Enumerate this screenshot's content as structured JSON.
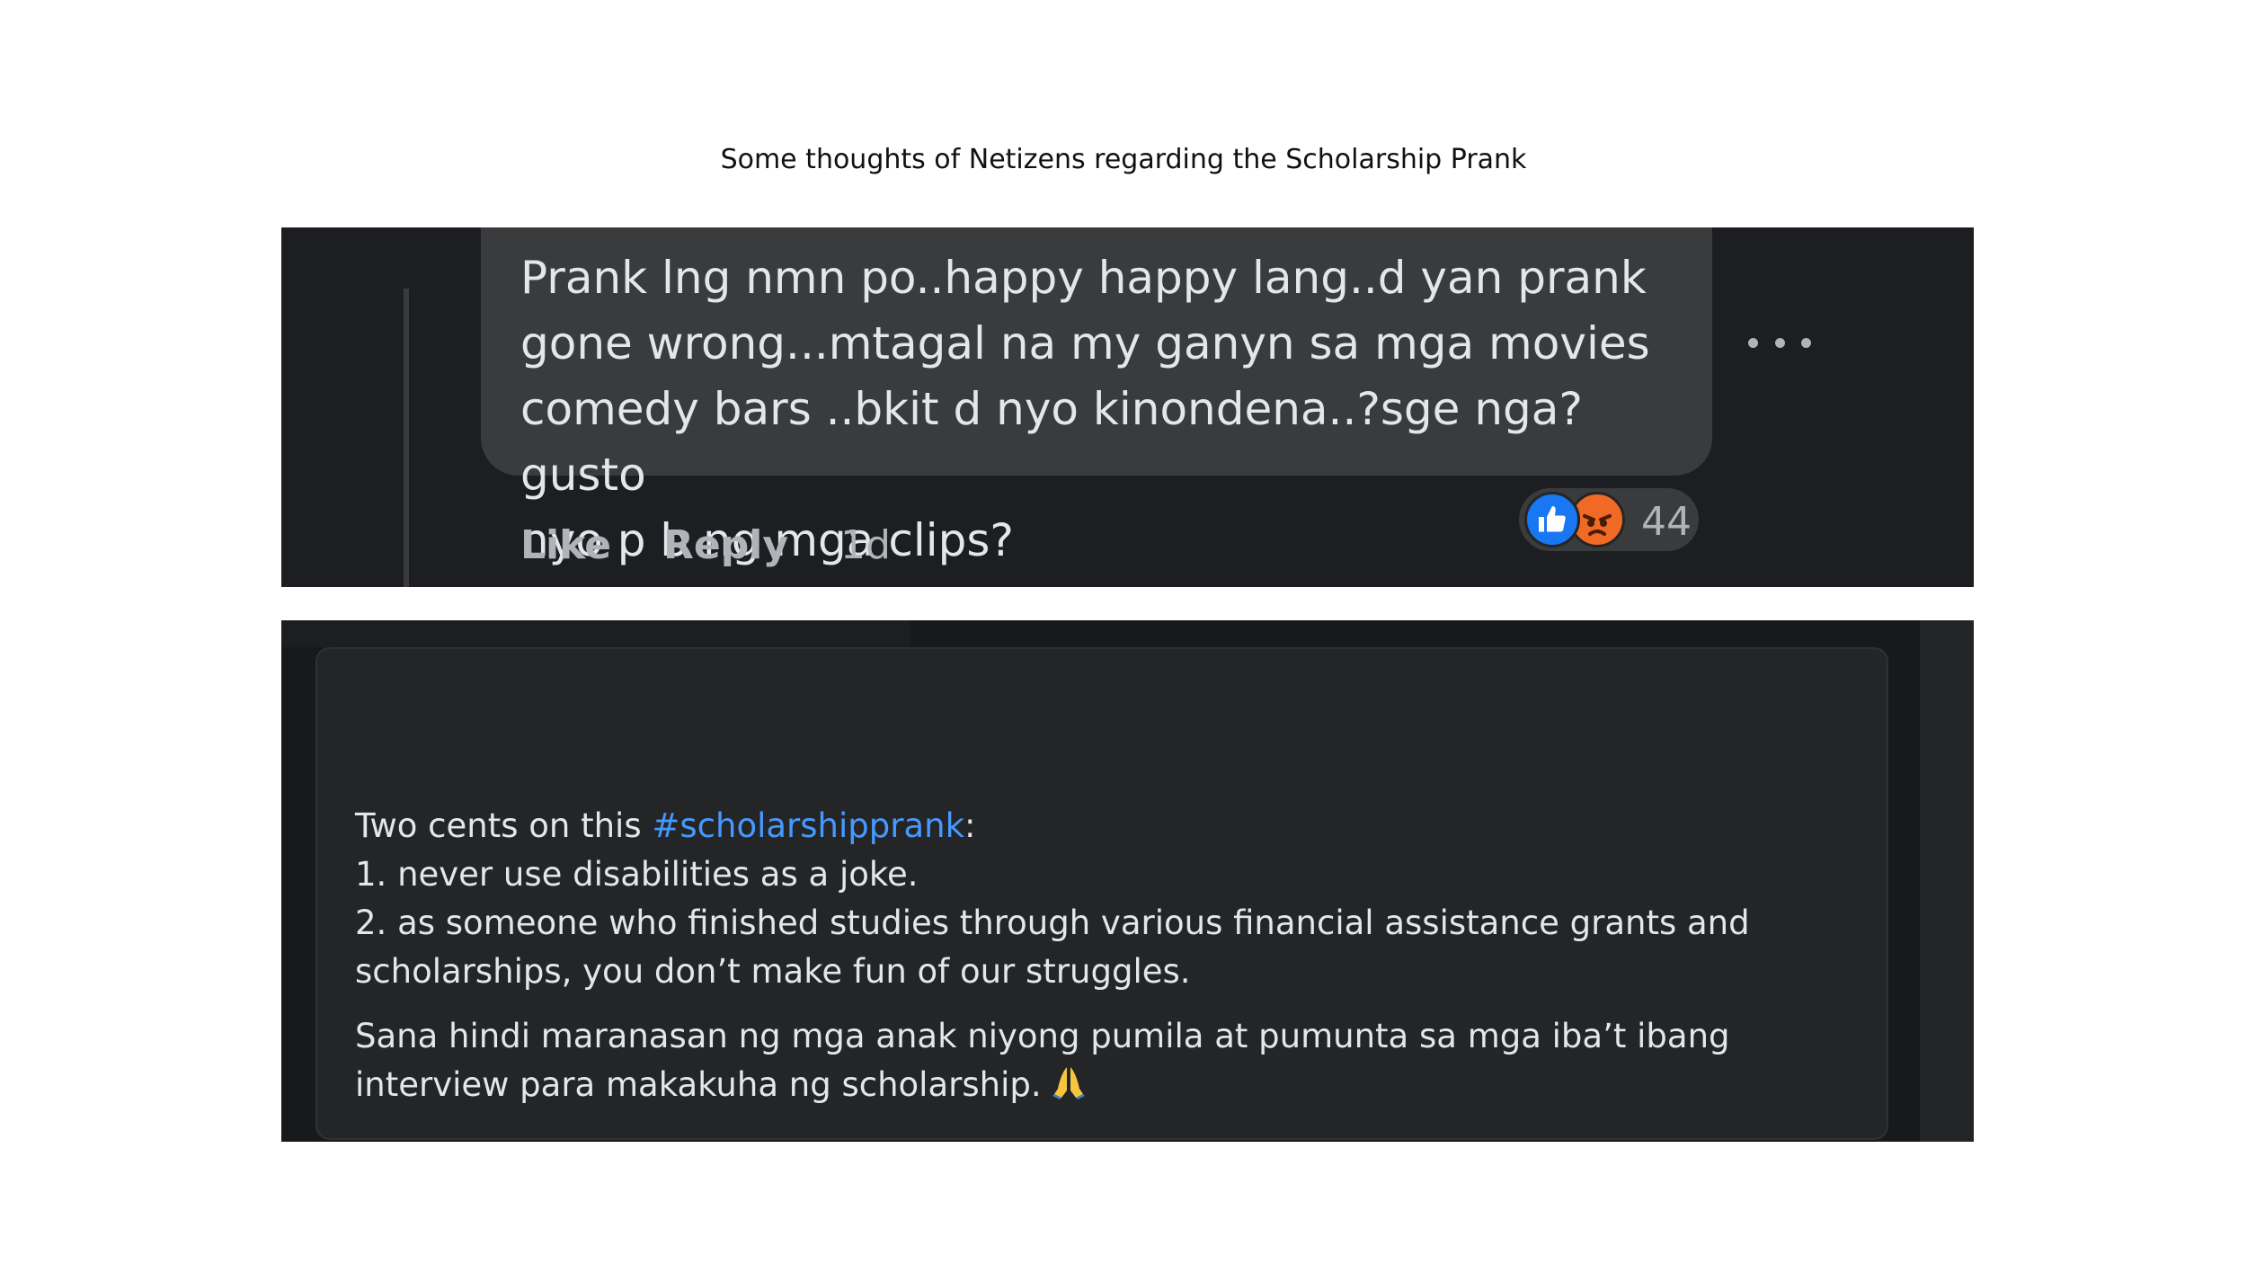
{
  "caption": "Some thoughts of Netizens regarding the Scholarship Prank",
  "comment": {
    "text": "Prank lng nmn po..happy happy lang..d yan prank\ngone wrong...mtagal na my ganyn sa mga movies\ncomedy bars ..bkit d nyo kinondena..?sge nga?gusto\nnyo p b ng mga clips?",
    "like_label": "Like",
    "reply_label": "Reply",
    "time": "1d",
    "reaction_count": "44",
    "reactions": [
      "like-icon",
      "angry-icon"
    ],
    "more_icon": "more-horizontal-icon"
  },
  "post": {
    "intro": "Two cents on this ",
    "hashtag": "#scholarshipprank",
    "intro_suffix": ":",
    "line1": "1. never use disabilities as a joke.",
    "line2": "2. as someone who finished studies through various financial assistance grants and scholarships, you don’t make fun of our struggles.",
    "line3": "Sana hindi maranasan ng mga anak niyong pumila at pumunta sa mga iba’t ibang interview para makakuha ng scholarship.",
    "emoji": "folded-hands-icon"
  },
  "colors": {
    "dark_bg": "#1c1e21",
    "bubble": "#3a3b3c",
    "text": "#e4e6eb",
    "muted": "#b0b3b8",
    "hashtag": "#4599ff",
    "like_blue": "#1877f2",
    "angry_orange": "#f06a25"
  }
}
